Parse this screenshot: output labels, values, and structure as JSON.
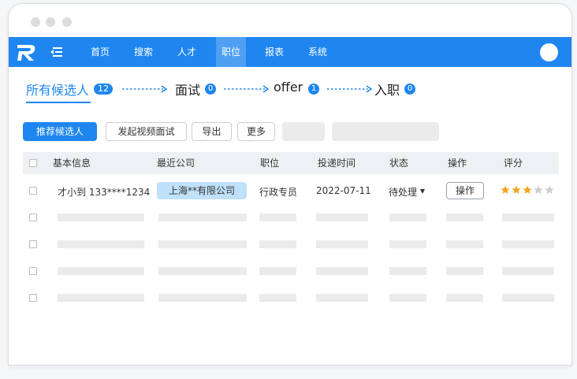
{
  "navbar": {
    "items": [
      "首页",
      "搜索",
      "人才",
      "职位",
      "报表",
      "系统"
    ],
    "active_index": 3,
    "color": "#1f86f0"
  },
  "steps": [
    {
      "label": "所有候选人",
      "count": "12"
    },
    {
      "label": "面试",
      "count": "0"
    },
    {
      "label": "offer",
      "count": "1"
    },
    {
      "label": "入职",
      "count": "0"
    }
  ],
  "toolbar": {
    "recommend": "推荐候选人",
    "video_interview": "发起视频面试",
    "export": "导出",
    "more": "更多"
  },
  "table": {
    "headers": [
      "基本信息",
      "最近公司",
      "职位",
      "投递时间",
      "状态",
      "操作",
      "评分"
    ],
    "row": {
      "basic_info": "才小到 133****1234",
      "company": "上海**有限公司",
      "position": "行政专员",
      "date": "2022-07-11",
      "status": "待处理",
      "action": "操作",
      "rating": 3,
      "rating_max": 5
    }
  },
  "colors": {
    "primary": "#1f86f0",
    "tag": "#bfe1f9",
    "star_on": "#f5a623",
    "star_off": "#cccccc",
    "placeholder": "#ebebeb"
  }
}
